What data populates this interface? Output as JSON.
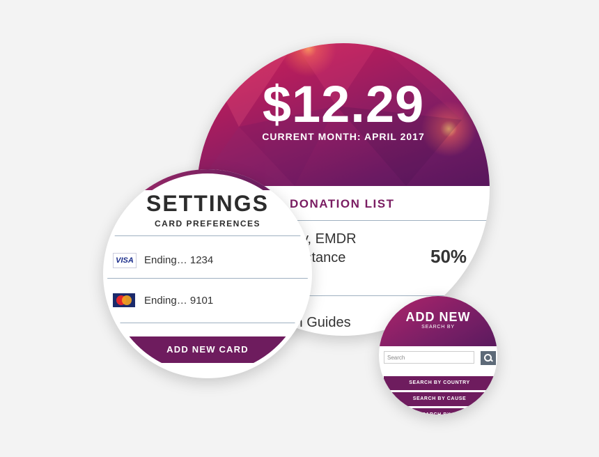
{
  "donation_summary": {
    "amount": "$12.29",
    "current_month": "CURRENT MONTH: APRIL 2017",
    "donation_list_label": "DONATION LIST",
    "items": [
      {
        "name_line1": "y, EMDR",
        "name_line2": "istance",
        "percent": "50%"
      },
      {
        "name_line1": "th Guides"
      }
    ]
  },
  "settings": {
    "title": "SETTINGS",
    "subtitle": "CARD PREFERENCES",
    "cards": [
      {
        "brand": "VISA",
        "icon": "visa-icon",
        "label": "Ending… 1234"
      },
      {
        "brand": "MasterCard",
        "icon": "mastercard-icon",
        "label": "Ending… 9101"
      }
    ],
    "add_button": "ADD NEW CARD"
  },
  "add_new": {
    "title": "ADD NEW",
    "subtitle": "SEARCH BY",
    "search_placeholder": "Search",
    "buttons": [
      "SEARCH BY COUNTRY",
      "SEARCH BY CAUSE",
      "SEARCH BY NO"
    ]
  },
  "colors": {
    "brand_purple": "#6e1c5e",
    "accent_magenta": "#b01d5d",
    "background": "#f3f3f3"
  }
}
